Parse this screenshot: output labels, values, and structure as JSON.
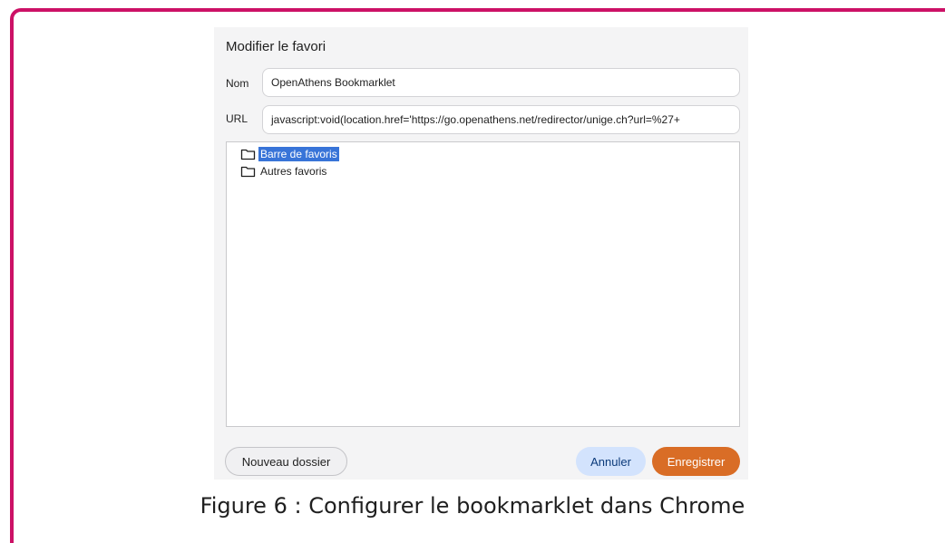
{
  "dialog": {
    "title": "Modifier le favori",
    "name_label": "Nom",
    "name_value": "OpenAthens Bookmarklet",
    "url_label": "URL",
    "url_value": "javascript:void(location.href='https://go.openathens.net/redirector/unige.ch?url=%27+"
  },
  "folders": [
    {
      "label": "Barre de favoris",
      "selected": true,
      "icon": "folder-icon"
    },
    {
      "label": "Autres favoris",
      "selected": false,
      "icon": "folder-icon"
    }
  ],
  "buttons": {
    "new_folder": "Nouveau dossier",
    "cancel": "Annuler",
    "save": "Enregistrer"
  },
  "caption": "Figure 6 : Configurer le bookmarklet dans Chrome",
  "colors": {
    "frame": "#cc1166",
    "selection": "#3874d8",
    "save_button": "#d96d26",
    "cancel_button": "#d3e3fd"
  }
}
